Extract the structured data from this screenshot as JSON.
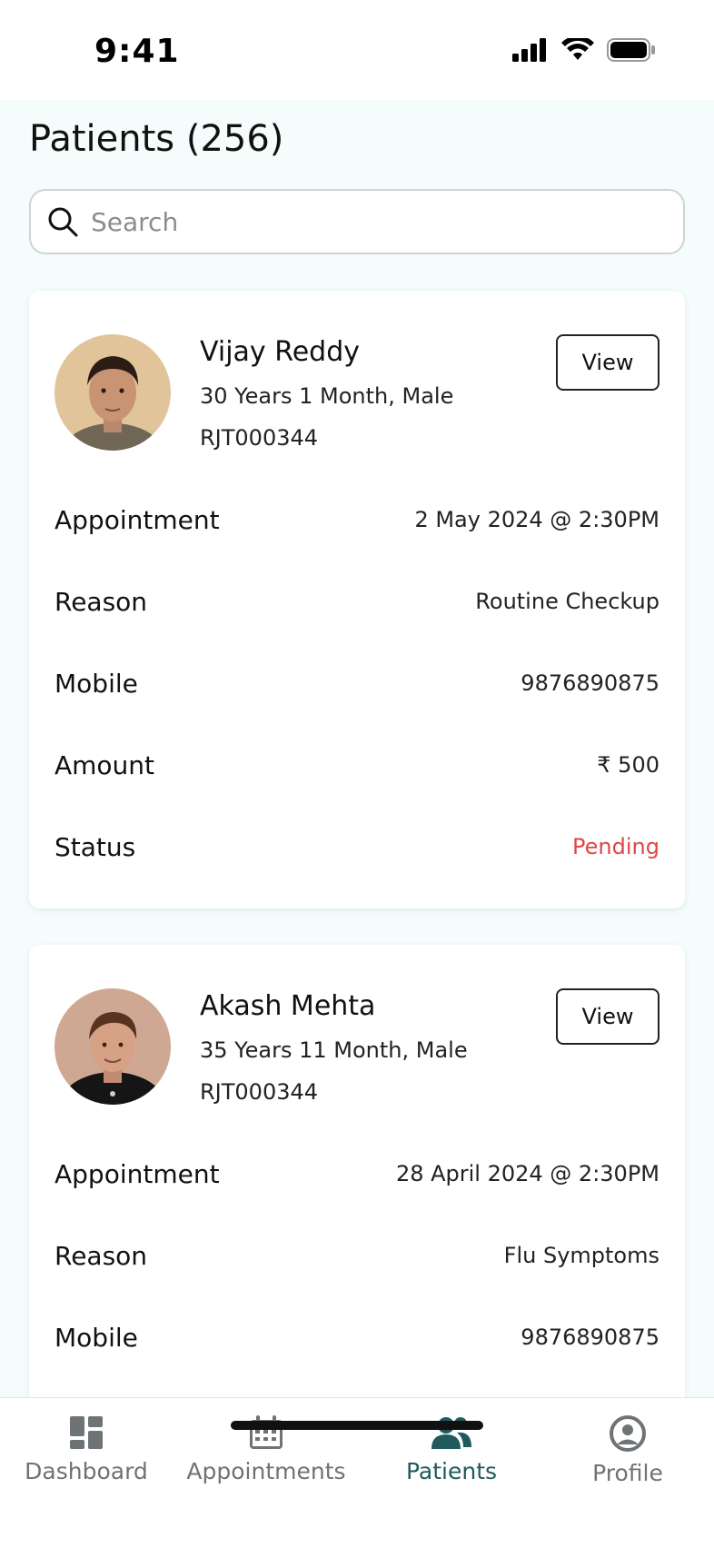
{
  "status_bar": {
    "time": "9:41"
  },
  "page": {
    "title": "Patients (256)"
  },
  "search": {
    "placeholder": "Search"
  },
  "patients": [
    {
      "name": "Vijay Reddy",
      "meta": "30 Years 1 Month, Male",
      "id": "RJT000344",
      "view_label": "View",
      "fields": [
        {
          "label": "Appointment",
          "value": "2 May 2024 @ 2:30PM"
        },
        {
          "label": "Reason",
          "value": "Routine Checkup"
        },
        {
          "label": "Mobile",
          "value": "9876890875"
        },
        {
          "label": "Amount",
          "value": "₹ 500"
        },
        {
          "label": "Status",
          "value": "Pending"
        }
      ]
    },
    {
      "name": "Akash Mehta",
      "meta": "35 Years 11 Month, Male",
      "id": "RJT000344",
      "view_label": "View",
      "fields": [
        {
          "label": "Appointment",
          "value": "28 April 2024 @ 2:30PM"
        },
        {
          "label": "Reason",
          "value": "Flu Symptoms"
        },
        {
          "label": "Mobile",
          "value": "9876890875"
        }
      ]
    }
  ],
  "bottom_nav": {
    "items": [
      {
        "label": "Dashboard",
        "icon": "dashboard-icon"
      },
      {
        "label": "Appointments",
        "icon": "calendar-icon"
      },
      {
        "label": "Patients",
        "icon": "patients-icon"
      },
      {
        "label": "Profile",
        "icon": "profile-icon"
      }
    ],
    "active": "Patients"
  },
  "colors": {
    "accent": "#1f5a5d",
    "status_pending": "#e04646",
    "background": "#f5fcfc"
  }
}
